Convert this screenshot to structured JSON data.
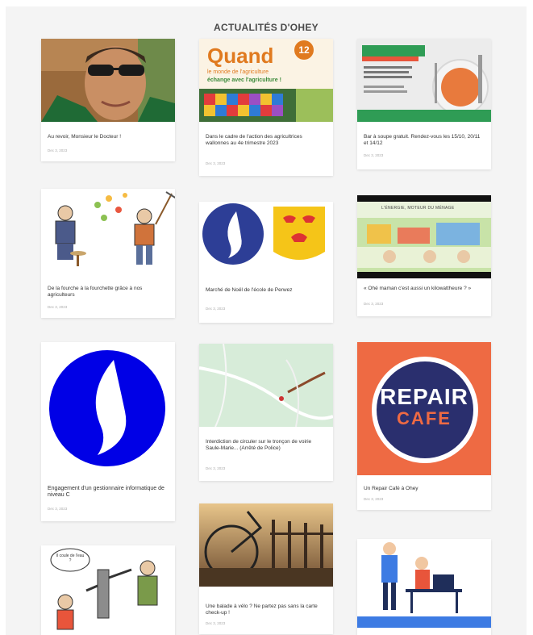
{
  "section": {
    "title": "ACTUALITÉS D'OHEY"
  },
  "colors": {
    "panel_bg": "#f4f4f4",
    "card_bg": "#ffffff",
    "police_blue": "#2d3e96",
    "repair_orange": "#ee6a43",
    "repair_navy": "#2a2f6e",
    "quand_orange": "#e07a1f",
    "map_green": "#d7ecd9"
  },
  "articles": [
    {
      "id": 1,
      "title": "Au revoir, Monsieur le Docteur !",
      "date": "Dec 3, 2023",
      "image": "portrait-sunglasses-photo"
    },
    {
      "id": 2,
      "title": "Dans le cadre de l'action des agricultrices wallonnes au 4e trimestre 2023",
      "date": "Dec 3, 2023",
      "image": "quand-le-monde-de-l-agriculture-poster",
      "poster_heading": "Quand",
      "poster_badge": "12",
      "poster_line1": "le monde de l'agriculture",
      "poster_line2": "échange avec l'agriculture !"
    },
    {
      "id": 3,
      "title": "Bar à soupe gratuit. Rendez-vous les 15/10, 20/11 et 14/12",
      "date": "Dec 3, 2023",
      "image": "soup-bar-flyer"
    },
    {
      "id": 4,
      "title": "De la fourche à la fourchette grâce à nos agriculteurs",
      "date": "Dec 3, 2023",
      "image": "farmers-illustration"
    },
    {
      "id": 5,
      "title": "Marché de Noël de l'école de Perwez",
      "date": "Dec 3, 2023",
      "image": "police-flame-and-coat-of-arms"
    },
    {
      "id": 6,
      "title": "« Ohé maman c'est aussi un kilowattheure ? »",
      "date": "Dec 3, 2023",
      "image": "energy-comic-banner",
      "banner_text": "L'ÉNERGIE, MOTEUR DU MÉNAGE"
    },
    {
      "id": 7,
      "title": "Engagement d'un gestionnaire informatique de niveau C",
      "date": "Dec 3, 2023",
      "image": "police-flame-logo"
    },
    {
      "id": 8,
      "title": "Interdiction de circuler sur le tronçon de voirie Saule-Marie... (Arrêté de Police)",
      "date": "Dec 3, 2023",
      "image": "road-map"
    },
    {
      "id": 9,
      "title": "Un Repair Café à Ohey",
      "date": "Dec 3, 2023",
      "image": "repair-cafe-logo",
      "logo_line1": "REPAIR",
      "logo_line2": "CAFE"
    },
    {
      "id": 10,
      "title": "",
      "date": "",
      "image": "water-pump-cartoon",
      "bubble_text": "Il coule de l'eau ?"
    },
    {
      "id": 11,
      "title": "Une balade à vélo ? Ne partez pas sans la carte check-up !",
      "date": "Dec 3, 2023",
      "image": "bicycle-sunset-photo"
    },
    {
      "id": 12,
      "title": "",
      "date": "",
      "image": "remote-work-illustration"
    }
  ]
}
